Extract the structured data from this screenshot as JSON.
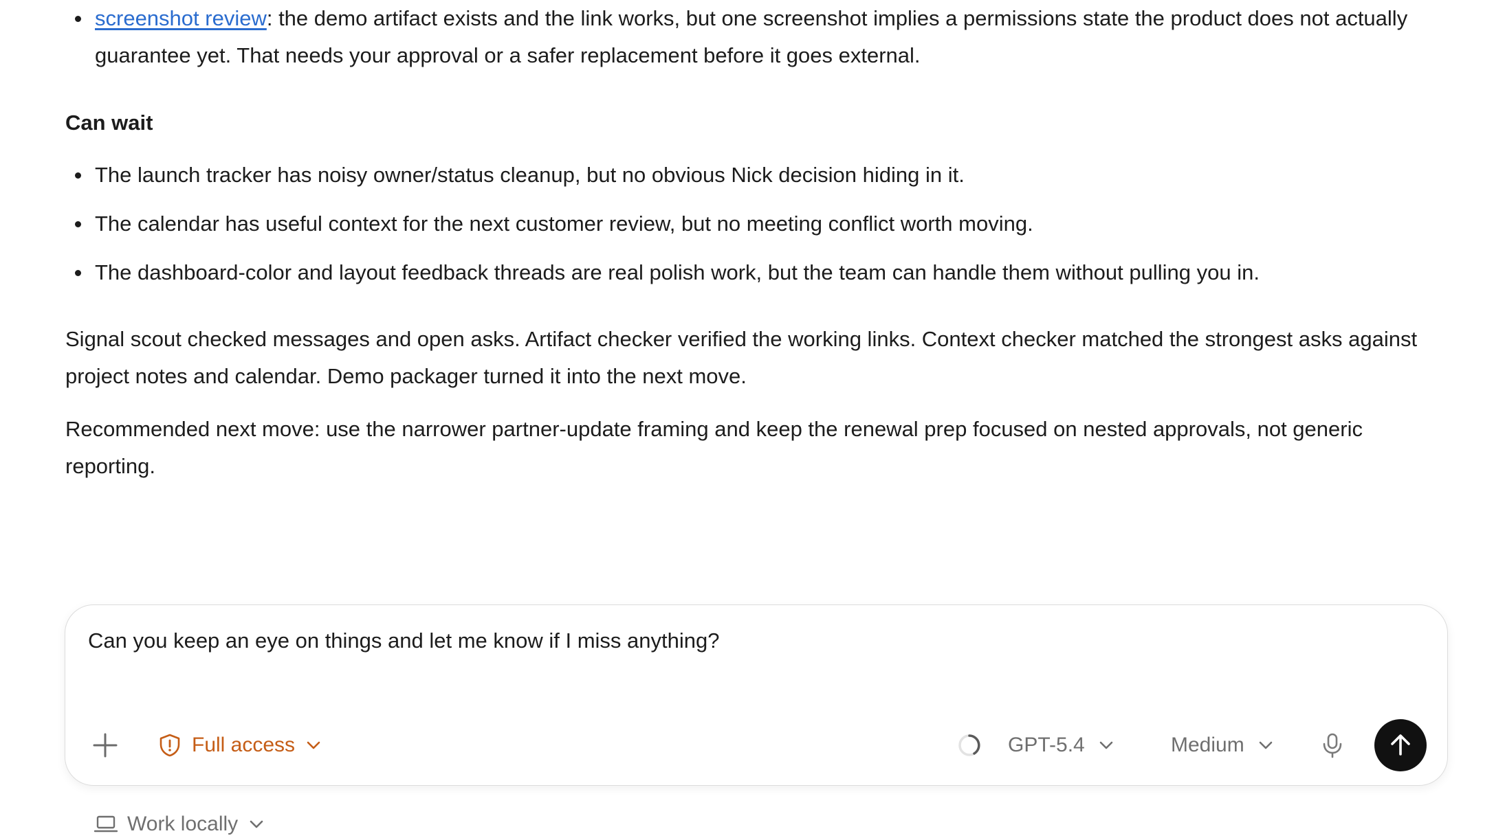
{
  "top_bullets": [
    {
      "link_text": "screenshot review",
      "text": ": the demo artifact exists and the link works, but one screenshot implies a permissions state the product does not actually guarantee yet. That needs your approval or a safer replacement before it goes external."
    }
  ],
  "can_wait": {
    "heading": "Can wait",
    "items": [
      "The launch tracker has noisy owner/status cleanup, but no obvious Nick decision hiding in it.",
      "The calendar has useful context for the next customer review, but no meeting conflict worth moving.",
      "The dashboard-color and layout feedback threads are real polish work, but the team can handle them without pulling you in."
    ]
  },
  "summary_paragraph": "Signal scout checked messages and open asks. Artifact checker verified the working links. Context checker matched the strongest asks against project notes and calendar. Demo packager turned it into the next move.",
  "recommendation_paragraph": "Recommended next move: use the narrower partner-update framing and keep the renewal prep focused on nested approvals, not generic reporting.",
  "composer": {
    "prompt_text": "Can you keep an eye on things and let me know if I miss anything?",
    "access_label": "Full access",
    "model_label": "GPT-5.4",
    "effort_label": "Medium",
    "icons": {
      "add": "plus-icon",
      "access": "shield-alert-icon",
      "status": "spinner-icon",
      "mic": "microphone-icon",
      "send": "arrow-up-icon"
    },
    "accent_color": "#c55d16",
    "send_color": "#111111"
  },
  "work_mode": {
    "label": "Work locally",
    "icon": "laptop-icon"
  }
}
